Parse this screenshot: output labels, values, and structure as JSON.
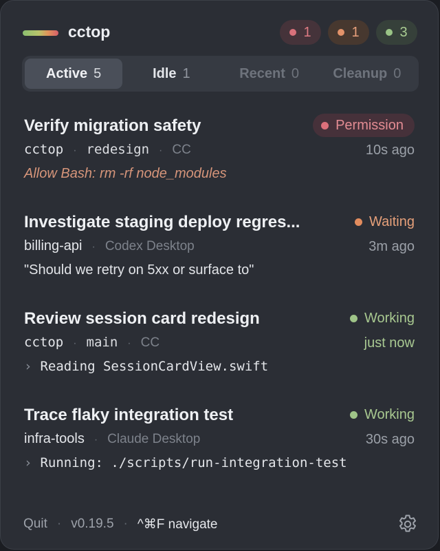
{
  "header": {
    "title": "cctop",
    "logo_colors": [
      "#8cc070",
      "#b8c46a",
      "#e0965a",
      "#d65e6a"
    ],
    "badges": {
      "permission_count": "1",
      "waiting_count": "1",
      "working_count": "3"
    }
  },
  "tabs": [
    {
      "label": "Active",
      "count": "5"
    },
    {
      "label": "Idle",
      "count": "1"
    },
    {
      "label": "Recent",
      "count": "0"
    },
    {
      "label": "Cleanup",
      "count": "0"
    }
  ],
  "sessions": [
    {
      "title": "Verify migration safety",
      "status": "Permission",
      "project": "cctop",
      "branch": "redesign",
      "source": "CC",
      "time": "10s ago",
      "detail": "Allow Bash: rm -rf node_modules"
    },
    {
      "title": "Investigate staging deploy regres...",
      "status": "Waiting",
      "project": "billing-api",
      "source": "Codex Desktop",
      "time": "3m ago",
      "detail": "\"Should we retry on 5xx or surface to\""
    },
    {
      "title": "Review session card redesign",
      "status": "Working",
      "project": "cctop",
      "branch": "main",
      "source": "CC",
      "time": "just now",
      "detail_prefix": "›",
      "detail": "Reading SessionCardView.swift"
    },
    {
      "title": "Trace flaky integration test",
      "status": "Working",
      "project": "infra-tools",
      "source": "Claude Desktop",
      "time": "30s ago",
      "detail_prefix": "›",
      "detail": "Running: ./scripts/run-integration-test"
    }
  ],
  "footer": {
    "quit_label": "Quit",
    "version": "v0.19.5",
    "separator": "·",
    "shortcut_hint": "^⌘F navigate",
    "settings_icon": "gear-icon"
  },
  "colors": {
    "permission": "#dd707b",
    "waiting": "#e28c5e",
    "working": "#9fc488",
    "panel_bg": "#2b2e35"
  }
}
